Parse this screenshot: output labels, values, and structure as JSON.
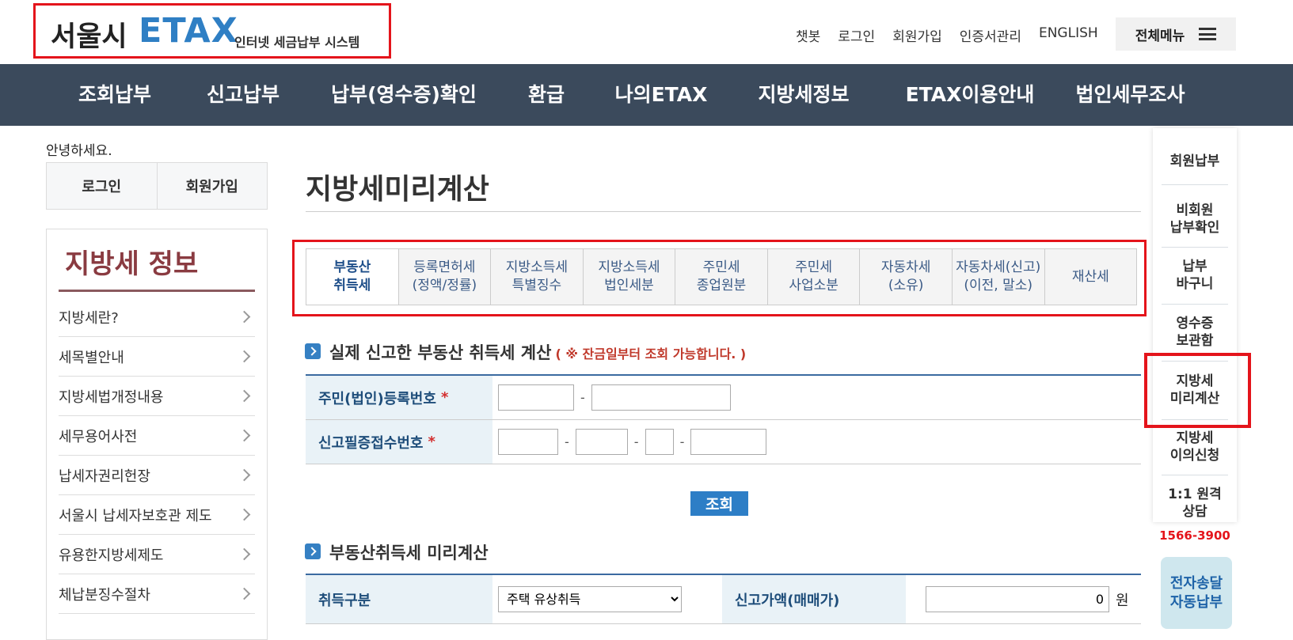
{
  "header": {
    "logo_city": "서울시",
    "logo_etax": "ETAX",
    "logo_sub": "인터넷 세금납부 시스템",
    "links": [
      "챗봇",
      "로그인",
      "회원가입",
      "인증서관리",
      "ENGLISH"
    ],
    "all_menu": "전체메뉴"
  },
  "nav": [
    "조회납부",
    "신고납부",
    "납부(영수증)확인",
    "환급",
    "나의ETAX",
    "지방세정보",
    "ETAX이용안내",
    "법인세무조사"
  ],
  "left": {
    "greeting": "안녕하세요.",
    "login": "로그인",
    "signup": "회원가입",
    "title": "지방세 정보",
    "items": [
      "지방세란?",
      "세목별안내",
      "지방세법개정내용",
      "세무용어사전",
      "납세자권리헌장",
      "서울시 납세자보호관 제도",
      "유용한지방세제도",
      "체납분징수절차"
    ]
  },
  "main": {
    "title": "지방세미리계산",
    "tabs": [
      "부동산\n취득세",
      "등록면허세\n(정액/정률)",
      "지방소득세\n특별징수",
      "지방소득세\n법인세분",
      "주민세\n종업원분",
      "주민세\n사업소분",
      "자동차세\n(소유)",
      "자동차세(신고)\n(이전, 말소)",
      "재산세"
    ],
    "section1": {
      "title": "실제 신고한 부동산 취득세 계산",
      "note": "( ※ 잔금일부터 조회 가능합니다. )",
      "row1_label": "주민(법인)등록번호",
      "row2_label": "신고필증접수번호",
      "star": "*",
      "dash": "-",
      "search_button": "조회"
    },
    "section2": {
      "title": "부동산취득세 미리계산",
      "acq_label": "취득구분",
      "acq_selected": "주택 유상취득",
      "price_label": "신고가액(매매가)",
      "price_value": "0",
      "won": "원"
    }
  },
  "quickbar": {
    "items": [
      "회원납부",
      "비회원\n납부확인",
      "납부\n바구니",
      "영수증\n보관함",
      "지방세\n미리계산",
      "지방세\n이의신청",
      "1:1 원격\n상담"
    ],
    "phone": "1566-3900",
    "auto": "전자송달\n자동납부"
  },
  "colors": {
    "nav_bg": "#3b4a5c",
    "highlight_red": "#e4141b",
    "accent_blue": "#2f7fc4",
    "left_title": "#8a3b41"
  }
}
